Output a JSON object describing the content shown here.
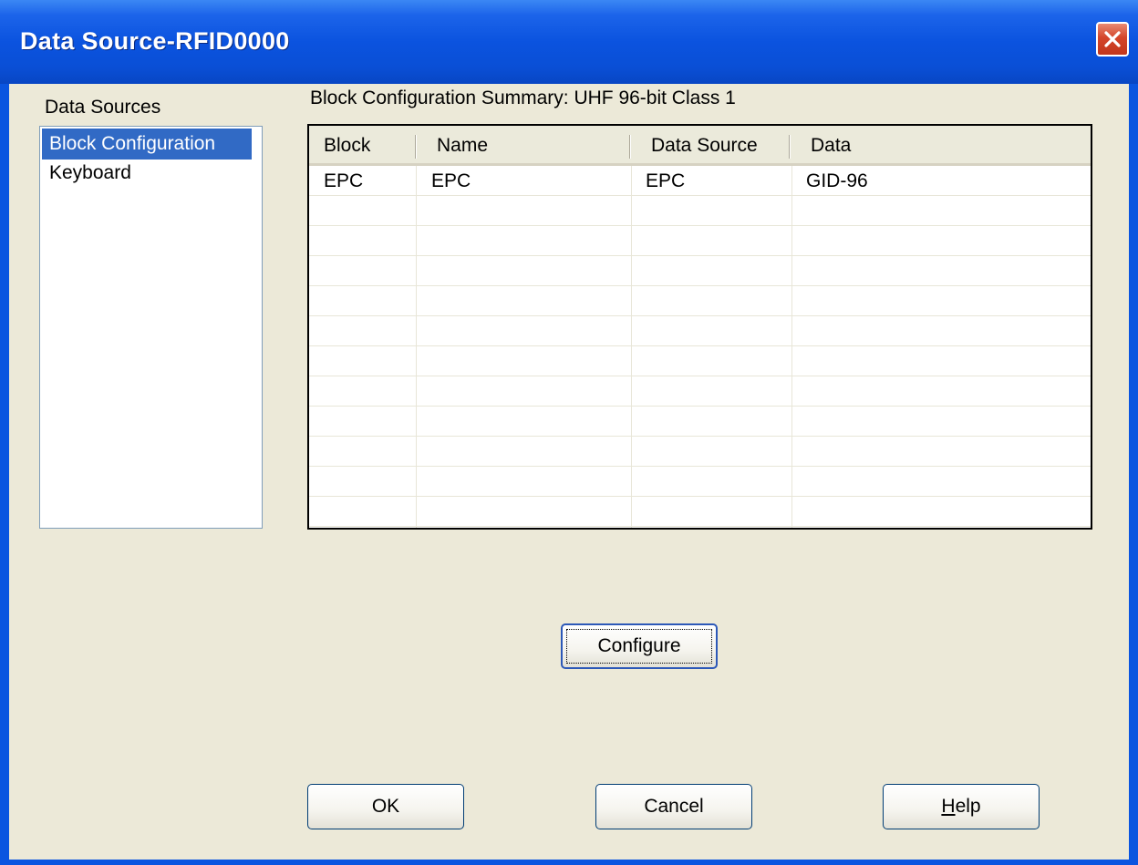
{
  "window": {
    "title": "Data Source-RFID0000"
  },
  "data_sources_panel": {
    "label": "Data Sources",
    "items": [
      {
        "label": "Block Configuration",
        "selected": true
      },
      {
        "label": "Keyboard",
        "selected": false
      }
    ]
  },
  "summary": {
    "title": "Block Configuration Summary: UHF 96-bit Class 1",
    "columns": [
      "Block",
      "Name",
      "Data Source",
      "Data"
    ],
    "rows": [
      [
        "EPC",
        "EPC",
        "EPC",
        "GID-96"
      ]
    ]
  },
  "buttons": {
    "configure": "Configure",
    "ok": "OK",
    "cancel": "Cancel",
    "help": "Help"
  },
  "colors": {
    "titlebar": "#0a55e0",
    "selection": "#316ac5",
    "dialog_bg": "#ece9d8"
  },
  "icons": {
    "close": "close-icon"
  }
}
